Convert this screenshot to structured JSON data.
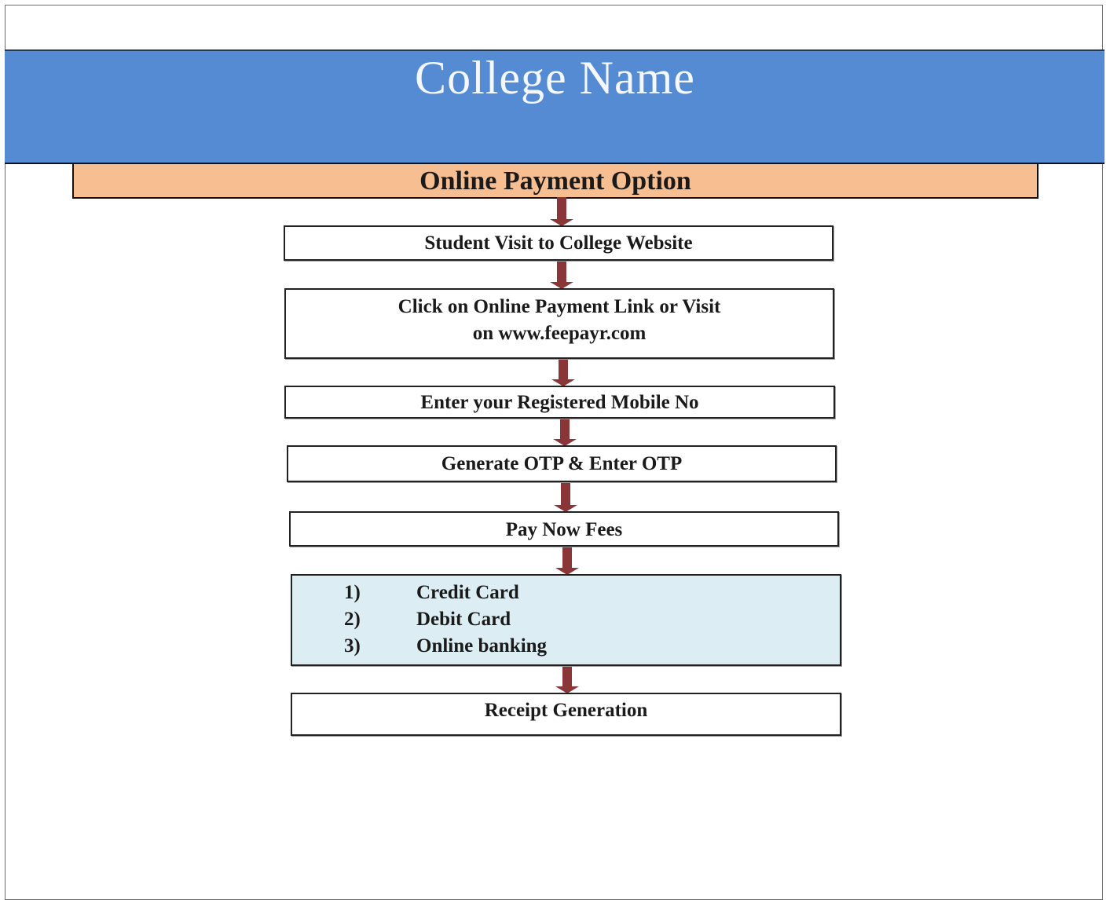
{
  "college_name": "College Name",
  "section_title": "Online Payment Option",
  "steps": [
    {
      "text": "Student Visit to College Website"
    },
    {
      "line1": "Click on Online Payment Link or Visit",
      "line2": "on www.feepayr.com"
    },
    {
      "text": "Enter your Registered Mobile No"
    },
    {
      "text": "Generate OTP & Enter OTP"
    },
    {
      "text": "Pay Now Fees"
    },
    {
      "text": "Receipt Generation"
    }
  ],
  "payment_methods": [
    {
      "num": "1)",
      "label": "Credit Card"
    },
    {
      "num": "2)",
      "label": "Debit Card"
    },
    {
      "num": "3)",
      "label": "Online banking"
    }
  ],
  "colors": {
    "header_band": "#558bd3",
    "option_band": "#f7be91",
    "methods_box": "#dcedf3",
    "arrow": "#8a3638"
  }
}
